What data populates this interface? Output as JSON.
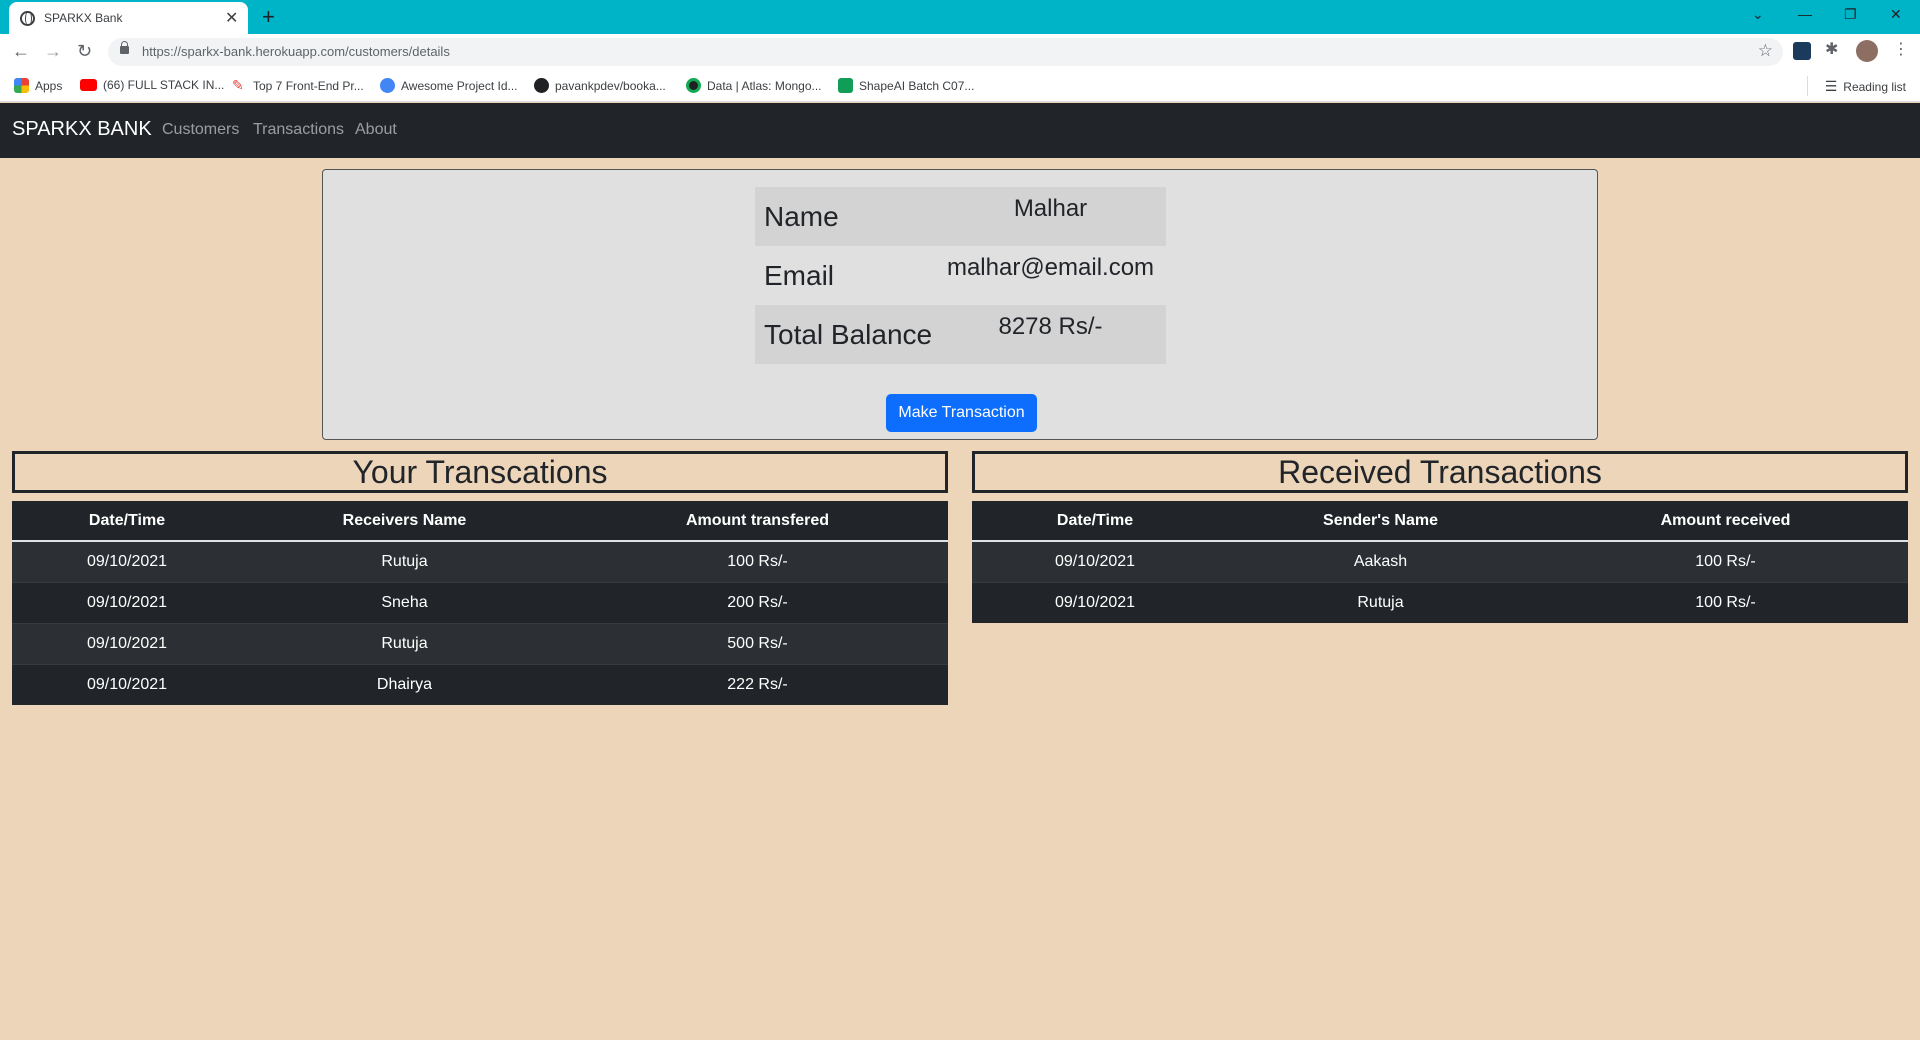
{
  "browser": {
    "tab_title": "SPARKX Bank",
    "url_host": "https://sparkx-bank.herokuapp.com",
    "url_path": "/customers/details",
    "bookmarks": [
      {
        "label": "Apps",
        "icon": "apps-grid-icon",
        "color": "#ea4335"
      },
      {
        "label": "(66) FULL STACK IN...",
        "icon": "youtube-icon",
        "color": "#ff0000"
      },
      {
        "label": "Top 7 Front-End Pr...",
        "icon": "pen-icon",
        "color": "#e8453c"
      },
      {
        "label": "Awesome Project Id...",
        "icon": "circle-logo-icon",
        "color": "#4285f4"
      },
      {
        "label": "pavankpdev/booka...",
        "icon": "github-icon",
        "color": "#202124"
      },
      {
        "label": "Data | Atlas: Mongo...",
        "icon": "mongodb-leaf-icon",
        "color": "#13aa52"
      },
      {
        "label": "ShapeAI Batch C07...",
        "icon": "sheets-icon",
        "color": "#0f9d58"
      }
    ],
    "reading_list": "Reading list"
  },
  "navbar": {
    "brand": "SPARKX BANK",
    "links": [
      "Customers",
      "Transactions",
      "About"
    ]
  },
  "customer": {
    "name_label": "Name",
    "name": "Malhar",
    "email_label": "Email",
    "email": "malhar@email.com",
    "balance_label": "Total Balance",
    "balance": "8278 Rs/-",
    "action_label": "Make Transaction"
  },
  "sent": {
    "heading": "Your Transcations",
    "columns": [
      "Date/Time",
      "Receivers Name",
      "Amount transfered"
    ],
    "rows": [
      [
        "09/10/2021",
        "Rutuja",
        "100 Rs/-"
      ],
      [
        "09/10/2021",
        "Sneha",
        "200 Rs/-"
      ],
      [
        "09/10/2021",
        "Rutuja",
        "500 Rs/-"
      ],
      [
        "09/10/2021",
        "Dhairya",
        "222 Rs/-"
      ]
    ]
  },
  "received": {
    "heading": "Received Transactions",
    "columns": [
      "Date/Time",
      "Sender's Name",
      "Amount received"
    ],
    "rows": [
      [
        "09/10/2021",
        "Aakash",
        "100 Rs/-"
      ],
      [
        "09/10/2021",
        "Rutuja",
        "100 Rs/-"
      ]
    ]
  },
  "colors": {
    "page_bg": "#ecd5b9",
    "navbar_bg": "#212529",
    "primary": "#0d6efd",
    "tabbar": "#00b4c8"
  }
}
